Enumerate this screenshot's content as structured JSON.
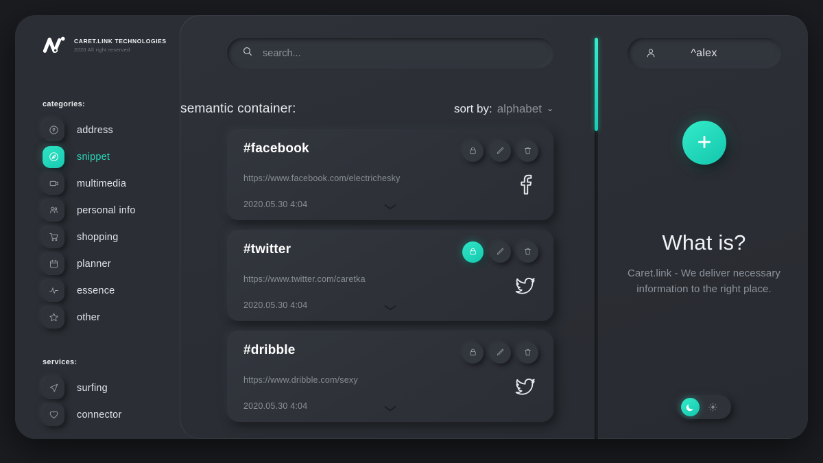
{
  "brand": {
    "name": "CARET.LINK TECHNOLOGIES",
    "subtitle": "2020 All right reserved",
    "logo_icon": "caret-logo-icon"
  },
  "sidebar": {
    "categories_label": "categories:",
    "services_label": "services:",
    "categories": [
      {
        "label": "address",
        "icon": "location-pin-icon",
        "active": false
      },
      {
        "label": "snippet",
        "icon": "feather-pen-icon",
        "active": true
      },
      {
        "label": "multimedia",
        "icon": "video-play-icon",
        "active": false
      },
      {
        "label": "personal info",
        "icon": "people-icon",
        "active": false
      },
      {
        "label": "shopping",
        "icon": "shopping-cart-icon",
        "active": false
      },
      {
        "label": "planner",
        "icon": "calendar-icon",
        "active": false
      },
      {
        "label": "essence",
        "icon": "activity-pulse-icon",
        "active": false
      },
      {
        "label": "other",
        "icon": "star-icon",
        "active": false
      }
    ],
    "services": [
      {
        "label": "surfing",
        "icon": "paper-plane-icon",
        "active": false
      },
      {
        "label": "connector",
        "icon": "heart-icon",
        "active": false
      }
    ]
  },
  "search": {
    "placeholder": "search...",
    "value": "",
    "icon": "search-icon"
  },
  "list": {
    "title": "semantic container:",
    "sort_label": "sort by:",
    "sort_value": "alphabet",
    "sort_caret": "⌄",
    "cards": [
      {
        "title": "#facebook",
        "url": "https://www.facebook.com/electrichesky",
        "date": "2020.05.30 4:04",
        "brand_icon": "facebook-icon",
        "lock_active": false
      },
      {
        "title": "#twitter",
        "url": "https://www.twitter.com/caretka",
        "date": "2020.05.30 4:04",
        "brand_icon": "twitter-icon",
        "lock_active": true
      },
      {
        "title": "#dribble",
        "url": "https://www.dribble.com/sexy",
        "date": "2020.05.30 4:04",
        "brand_icon": "twitter-icon",
        "lock_active": false
      }
    ],
    "actions": {
      "lock": "lock-icon",
      "edit": "pencil-icon",
      "delete": "trash-icon"
    }
  },
  "scrollbar": {
    "thumb_percent": 23
  },
  "user": {
    "name": "^alex",
    "icon": "user-icon"
  },
  "add_button": {
    "icon": "plus-icon"
  },
  "about": {
    "title": "What is?",
    "body": "Caret.link - We deliver necessary information to the right place."
  },
  "theme_toggle": {
    "dark_icon": "moon-icon",
    "light_icon": "sun-icon",
    "active": "dark"
  },
  "colors": {
    "accent": "#1ad6ba",
    "panel": "#2b2e34",
    "card": "#32363d",
    "text_primary": "#f1f3f6",
    "text_muted": "#8e949c"
  }
}
